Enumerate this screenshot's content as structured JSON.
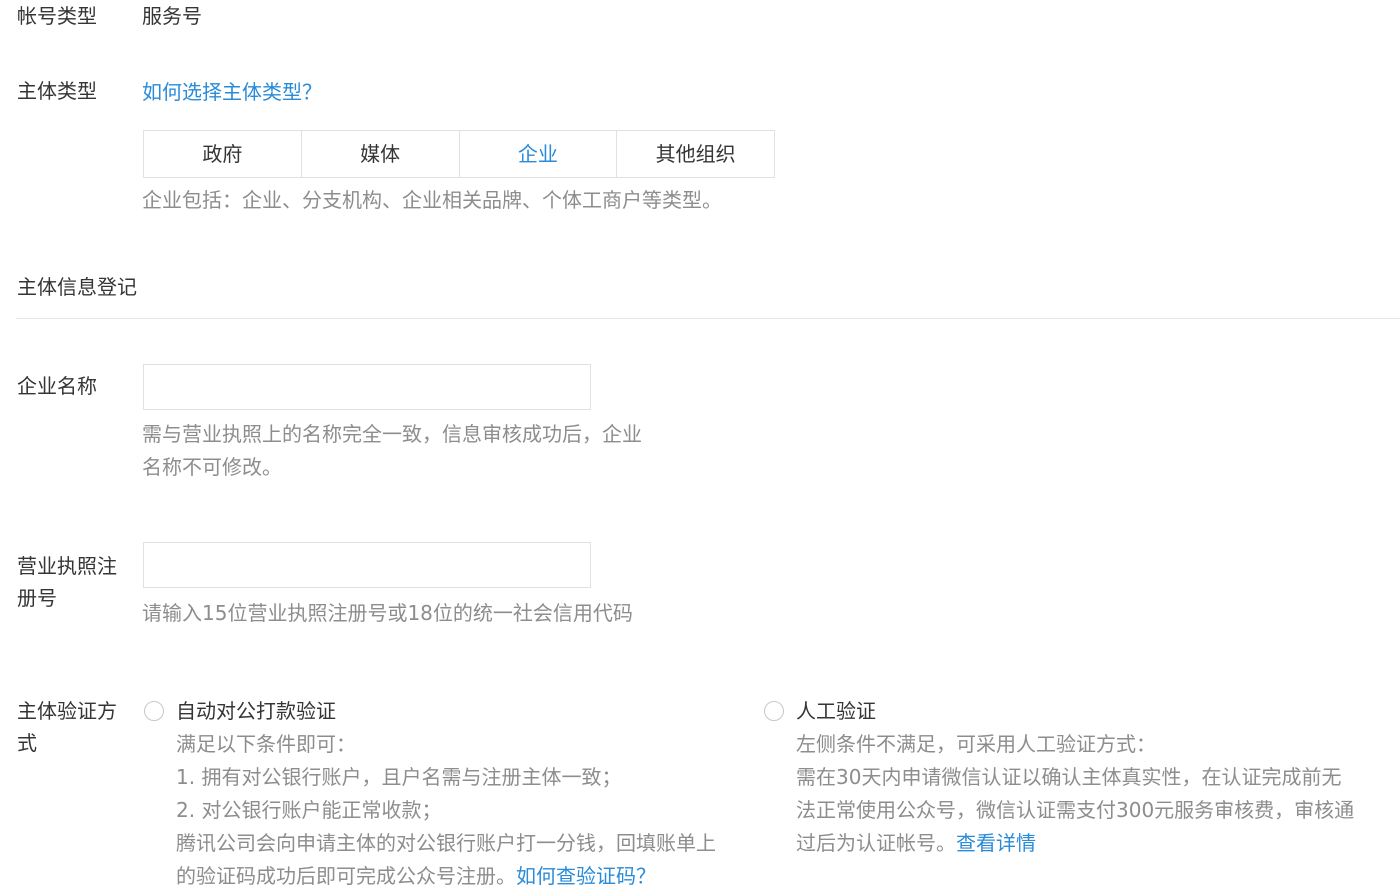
{
  "account_type": {
    "label": "帐号类型",
    "value": "服务号"
  },
  "subject_type": {
    "label": "主体类型",
    "help_link": "如何选择主体类型？",
    "tabs": [
      "政府",
      "媒体",
      "企业",
      "其他组织"
    ],
    "selected": "企业",
    "description": "企业包括：企业、分支机构、企业相关品牌、个体工商户等类型。"
  },
  "section": {
    "title": "主体信息登记"
  },
  "company_name": {
    "label": "企业名称",
    "value": "",
    "hint_line1": "需与营业执照上的名称完全一致，信息审核成功后，企业",
    "hint_line2": "名称不可修改。"
  },
  "license_number": {
    "label_line1": "营业执照注",
    "label_line2": "册号",
    "value": "",
    "hint": "请输入15位营业执照注册号或18位的统一社会信用代码"
  },
  "verification": {
    "label_line1": "主体验证方",
    "label_line2": "式",
    "auto": {
      "title": "自动对公打款验证",
      "lines": [
        "满足以下条件即可：",
        "1. 拥有对公银行账户，且户名需与注册主体一致；",
        "2. 对公银行账户能正常收款；",
        "腾讯公司会向申请主体的对公银行账户打一分钱，回填账单上",
        "的验证码成功后即可完成公众号注册。"
      ],
      "link": "如何查验证码？"
    },
    "manual": {
      "title": "人工验证",
      "lines": [
        "左侧条件不满足，可采用人工验证方式：",
        "需在30天内申请微信认证以确认主体真实性，在认证完成前无",
        "法正常使用公众号，微信认证需支付300元服务审核费，审核通",
        "过后为认证帐号。"
      ],
      "link": "查看详情"
    }
  }
}
